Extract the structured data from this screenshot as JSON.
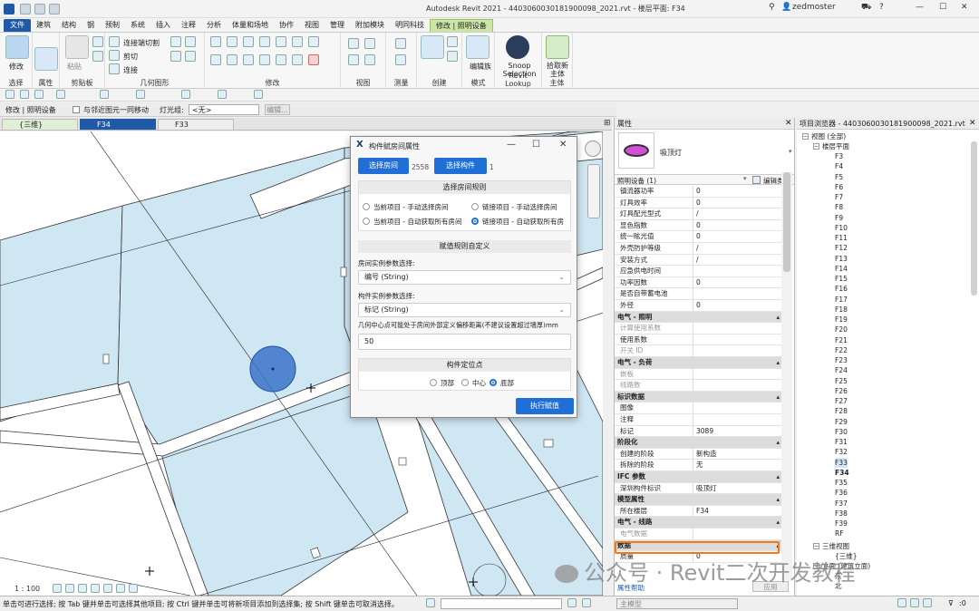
{
  "window": {
    "title": "Autodesk Revit 2021 - 4403060030181900098_2021.rvt - 楼层平面: F34",
    "user": "zedmoster"
  },
  "ribbon_tabs": [
    "文件",
    "建筑",
    "结构",
    "钢",
    "预制",
    "系统",
    "插入",
    "注释",
    "分析",
    "体量和场地",
    "协作",
    "视图",
    "管理",
    "附加模块",
    "明同科技",
    "修改 | 照明设备"
  ],
  "ribbon": {
    "select": {
      "label": "选择",
      "sub": "修改"
    },
    "properties": {
      "label": "属性"
    },
    "clipboard": {
      "label": "剪贴板",
      "paste": "粘贴"
    },
    "geometry": {
      "label": "几何图形",
      "items": [
        "连接端切割",
        "剪切",
        "连接"
      ]
    },
    "modify": {
      "label": "修改"
    },
    "view": {
      "label": "视图"
    },
    "measure": {
      "label": "测量"
    },
    "create": {
      "label": "创建"
    },
    "mode": {
      "label": "模式",
      "edit_family": "编辑族"
    },
    "lookup": {
      "label": "Revit Lookup",
      "snoop": "Snoop Selection"
    },
    "host": {
      "label": "主体",
      "pickup": "拾取新主体"
    }
  },
  "options_bar": {
    "context": "修改 | 照明设备",
    "checkbox_label": "与邻近图元一同移动",
    "light_group_label": "灯光组:",
    "light_group_value": "<无>",
    "edit_btn": "编辑..."
  },
  "view_tabs": [
    {
      "label": "{三维}"
    },
    {
      "label": "F34"
    },
    {
      "label": "F33"
    }
  ],
  "dialog": {
    "title": "构件赋房间属性",
    "select_room_btn": "选择房间",
    "room_count": "2558",
    "select_comp_btn": "选择构件",
    "comp_count": "1",
    "rule_section": "选择房间规则",
    "rules": [
      "当前项目 - 手动选择房间",
      "链接项目 - 手动选择房间",
      "当前项目 - 自动获取所有房间",
      "链接项目 - 自动获取所有房"
    ],
    "assign_section": "赋值规则自定义",
    "room_param_label": "房间实例参数选择:",
    "room_param_value": "编号 (String)",
    "comp_param_label": "构件实例参数选择:",
    "comp_param_value": "标记 (String)",
    "offset_label": "几何中心点可能处于房间外部定义偏移距离(不建议设置超过墙厚)mm",
    "offset_value": "50",
    "locate_section": "构件定位点",
    "locate_options": [
      "顶部",
      "中心",
      "底部"
    ],
    "execute_btn": "执行赋值"
  },
  "properties": {
    "header": "属性",
    "type_name": "吸顶灯",
    "filter": "照明设备 (1)",
    "edit_type": "编辑类型",
    "apply": "应用",
    "help": "属性帮助",
    "rows": [
      {
        "k": "镇流器功率",
        "v": "0"
      },
      {
        "k": "灯具效率",
        "v": "0"
      },
      {
        "k": "灯具配光型式",
        "v": "/"
      },
      {
        "k": "显色指数",
        "v": "0"
      },
      {
        "k": "统一眩光值",
        "v": "0"
      },
      {
        "k": "外壳防护等级",
        "v": "/"
      },
      {
        "k": "安装方式",
        "v": "/"
      },
      {
        "k": "应急供电时间",
        "v": ""
      },
      {
        "k": "功率因数",
        "v": "0"
      },
      {
        "k": "是否自带蓄电池",
        "v": ""
      },
      {
        "k": "外径",
        "v": "0"
      },
      {
        "k": "电气 - 照明",
        "v": "",
        "grp": true
      },
      {
        "k": "计算使用系数",
        "v": "",
        "dim": true
      },
      {
        "k": "使用系数",
        "v": ""
      },
      {
        "k": "开关 ID",
        "v": "",
        "dim": true
      },
      {
        "k": "电气 - 负荷",
        "v": "",
        "grp": true
      },
      {
        "k": "嵌板",
        "v": "",
        "dim": true
      },
      {
        "k": "线路数",
        "v": "",
        "dim": true
      },
      {
        "k": "标识数据",
        "v": "",
        "grp": true
      },
      {
        "k": "图像",
        "v": ""
      },
      {
        "k": "注释",
        "v": ""
      },
      {
        "k": "标记",
        "v": "3089"
      },
      {
        "k": "阶段化",
        "v": "",
        "grp": true
      },
      {
        "k": "创建的阶段",
        "v": "新构造"
      },
      {
        "k": "拆除的阶段",
        "v": "无"
      },
      {
        "k": "IFC 参数",
        "v": "",
        "grp": true
      },
      {
        "k": "深圳构件标识",
        "v": "吸顶灯"
      },
      {
        "k": "模型属性",
        "v": "",
        "grp": true
      },
      {
        "k": "所在楼层",
        "v": "F34"
      },
      {
        "k": "电气 - 线路",
        "v": "",
        "grp": true
      },
      {
        "k": "电气数据",
        "v": "",
        "dim": true
      },
      {
        "k": "数据",
        "v": "",
        "grp": true
      },
      {
        "k": "质量",
        "v": "0"
      }
    ]
  },
  "browser": {
    "header": "项目浏览器 - 4403060030181900098_2021.rvt",
    "root": "视图 (全部)",
    "floor_plans": "楼层平面",
    "floors": [
      "F3",
      "F4",
      "F5",
      "F6",
      "F7",
      "F8",
      "F9",
      "F10",
      "F11",
      "F12",
      "F13",
      "F14",
      "F15",
      "F16",
      "F17",
      "F18",
      "F19",
      "F20",
      "F21",
      "F22",
      "F23",
      "F24",
      "F25",
      "F26",
      "F27",
      "F28",
      "F29",
      "F30",
      "F31",
      "F32",
      "F33",
      "F34",
      "F35",
      "F36",
      "F37",
      "F38",
      "F39",
      "RF"
    ],
    "views3d": "三维视图",
    "view3d_item": "{三维}",
    "elev": "立面 (建筑立面)",
    "elev_items": [
      "东",
      "北"
    ]
  },
  "view_control": {
    "scale": "1 : 100"
  },
  "status": {
    "text": "单击可进行选择; 按 Tab 键并单击可选择其他项目; 按 Ctrl 键并单击可将新项目添加到选择集; 按 Shift 键单击可取消选择。",
    "model": "主模型",
    "zero": ":0"
  },
  "watermark": "公众号 · Revit二次开发教程",
  "colors": {
    "accent": "#1f6fd6",
    "highlight": "#f07a1a",
    "room_fill": "#cfe6f3",
    "light": "#3c73c8"
  }
}
